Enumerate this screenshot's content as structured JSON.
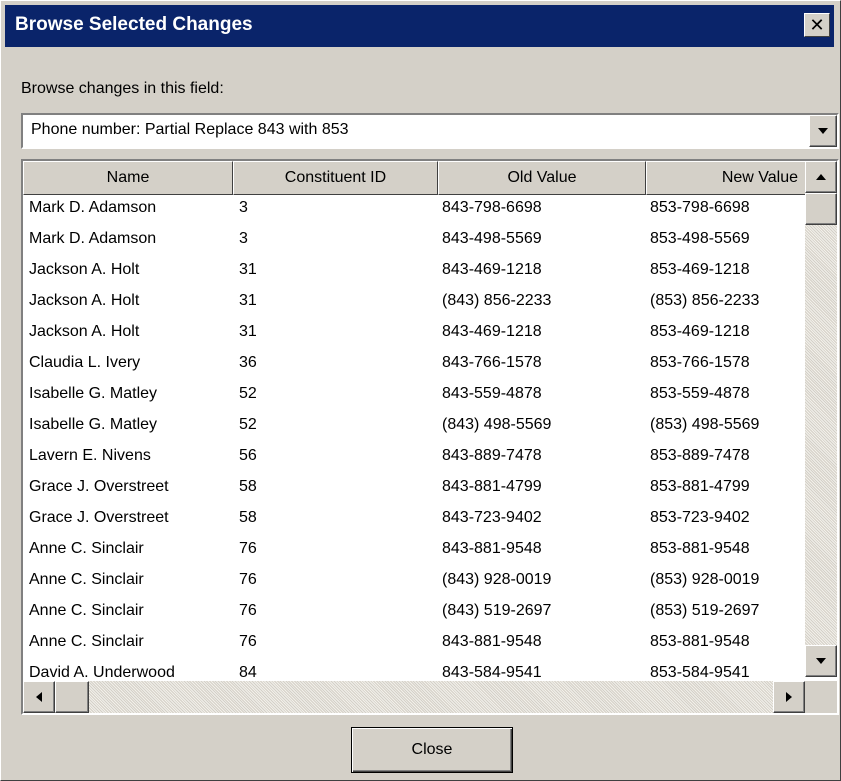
{
  "window": {
    "title": "Browse Selected Changes",
    "close_glyph": "✕"
  },
  "field": {
    "label": "Browse changes in this field:",
    "selected": "Phone number:  Partial Replace 843 with 853"
  },
  "table": {
    "columns": [
      "Name",
      "Constituent ID",
      "Old Value",
      "New Value"
    ],
    "rows": [
      [
        "Mark D. Adamson",
        "3",
        "843-798-6698",
        "853-798-6698"
      ],
      [
        "Mark D. Adamson",
        "3",
        "843-498-5569",
        "853-498-5569"
      ],
      [
        "Jackson A. Holt",
        "31",
        "843-469-1218",
        "853-469-1218"
      ],
      [
        "Jackson A. Holt",
        "31",
        "(843) 856-2233",
        "(853) 856-2233"
      ],
      [
        "Jackson A. Holt",
        "31",
        "843-469-1218",
        "853-469-1218"
      ],
      [
        "Claudia L. Ivery",
        "36",
        "843-766-1578",
        "853-766-1578"
      ],
      [
        "Isabelle G. Matley",
        "52",
        "843-559-4878",
        "853-559-4878"
      ],
      [
        "Isabelle G. Matley",
        "52",
        "(843) 498-5569",
        "(853) 498-5569"
      ],
      [
        "Lavern E. Nivens",
        "56",
        "843-889-7478",
        "853-889-7478"
      ],
      [
        "Grace J. Overstreet",
        "58",
        "843-881-4799",
        "853-881-4799"
      ],
      [
        "Grace J. Overstreet",
        "58",
        "843-723-9402",
        "853-723-9402"
      ],
      [
        "Anne C. Sinclair",
        "76",
        "843-881-9548",
        "853-881-9548"
      ],
      [
        "Anne C. Sinclair",
        "76",
        "(843) 928-0019",
        "(853) 928-0019"
      ],
      [
        "Anne C. Sinclair",
        "76",
        "(843) 519-2697",
        "(853) 519-2697"
      ],
      [
        "Anne C. Sinclair",
        "76",
        "843-881-9548",
        "853-881-9548"
      ],
      [
        "David A. Underwood",
        "84",
        "843-584-9541",
        "853-584-9541"
      ]
    ]
  },
  "buttons": {
    "close_label": "Close"
  },
  "colors": {
    "titlebar": "#0a246a",
    "face": "#d4d0c8",
    "window_bg": "#ffffff"
  },
  "icons": {
    "dropdown": "chevron-down-icon",
    "scroll_up": "arrow-up-icon",
    "scroll_down": "arrow-down-icon",
    "scroll_left": "arrow-left-icon",
    "scroll_right": "arrow-right-icon"
  }
}
